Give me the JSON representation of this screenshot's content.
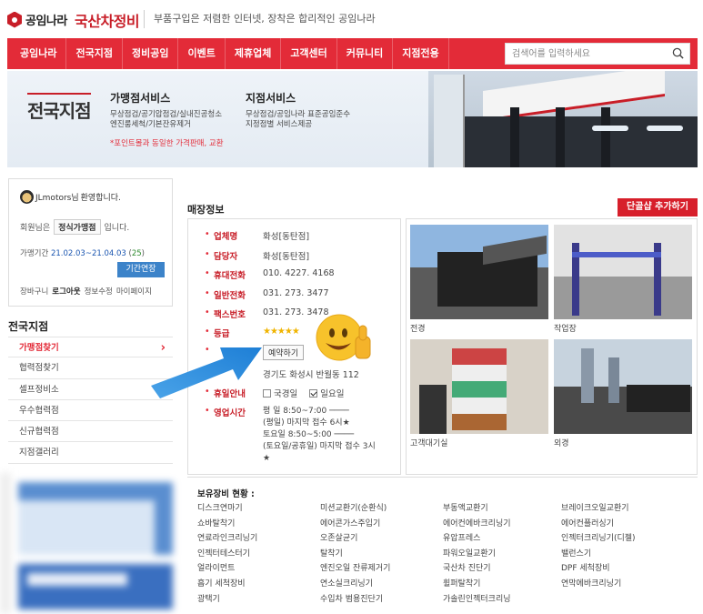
{
  "header": {
    "logo_text": "공임나라",
    "logo_sub": "국산차정비",
    "slogan": "부품구입은 저렴한 인터넷, 장착은 합리적인 공임나라"
  },
  "nav": {
    "items": [
      "공임나라",
      "전국지점",
      "정비공임",
      "이벤트",
      "제휴업체",
      "고객센터",
      "커뮤니티",
      "지점전용"
    ],
    "search_placeholder": "검색어를 입력하세요"
  },
  "banner": {
    "title": "전국지점",
    "service1": {
      "title": "가맹점서비스",
      "lines": [
        "무상점검/공기압점검/실내진공청소",
        "엔진룸세척/기본잔유제거"
      ],
      "note": "*포인트몰과 동일한 가격판매, 교환"
    },
    "service2": {
      "title": "지점서비스",
      "lines": [
        "무상점검/공임나라 표준공임준수",
        "지정점별 서비스제공"
      ]
    }
  },
  "login": {
    "user": "JLmotors님",
    "greeting": "환영합니다.",
    "member_prefix": "회원님은",
    "grade": "정식가맹점",
    "member_suffix": "입니다.",
    "period_label": "가맹기간",
    "period_dates": "21.02.03~21.04.03",
    "period_days": "25",
    "extend_button": "기간연장",
    "links": [
      "장바구니",
      "로그아웃",
      "정보수정",
      "마이페이지"
    ]
  },
  "sidebar": {
    "title": "전국지점",
    "items": [
      "가맹점찾기",
      "협력점찾기",
      "셀프정비소",
      "우수협력점",
      "신규협력점",
      "지점갤러리"
    ]
  },
  "store": {
    "section_title": "매장정보",
    "add_button": "단골샵 추가하기",
    "fields": {
      "type_label": "업체명",
      "type_value": "화성[동탄점]",
      "manager_label": "담당자",
      "manager_value": "화성[동탄점]",
      "mobile_label": "휴대전화",
      "mobile_value": "010. 4227. 4168",
      "phone_label": "일반전화",
      "phone_value": "031. 273. 3477",
      "fax_label": "팩스번호",
      "fax_value": "031. 273. 3478",
      "grade_label": "등급",
      "grade_stars": "★★★★★",
      "reserve_button": "예약하기",
      "address_value": "경기도 화성시 반월동 112",
      "holiday_label": "휴일안내",
      "holiday_national": "국경일",
      "holiday_sunday": "일요일",
      "hours_label": "영업시간",
      "hours_lines": [
        "평 일 8:50~7:00 ────",
        "(평일) 마지막 접수 6시★",
        "토요일 8:50~5:00 ────",
        "(토요일/공휴일) 마지막 접수 3시★"
      ]
    },
    "photos": [
      "전경",
      "작업장",
      "고객대기실",
      "외경"
    ]
  },
  "equipment": {
    "title": "보유장비 현황 :",
    "items": [
      "디스크연마기",
      "미션교환기(순환식)",
      "부동액교환기",
      "브레이크오일교환기",
      "쇼바탈착기",
      "에어콘가스주입기",
      "에어컨에바크리닝기",
      "에어컨플러싱기",
      "연료라인크리닝기",
      "오존살균기",
      "유압프레스",
      "인젝터크리닝기(디젤)",
      "인젝터테스터기",
      "탈착기",
      "파워오일교환기",
      "밸런스기",
      "얼라이먼트",
      "엔진오일 잔류제거기",
      "국산차 진단기",
      "DPF 세척장비",
      "흡기 세척장비",
      "연소실크리닝기",
      "휠퍼탈착기",
      "연막에바크리닝기",
      "광택기",
      "수입차 범용진단기",
      "가솔린인젝터크리닝",
      ""
    ]
  },
  "colors": {
    "brand_red": "#e32b38",
    "link_blue": "#3c83c9",
    "star": "#f0b400"
  }
}
